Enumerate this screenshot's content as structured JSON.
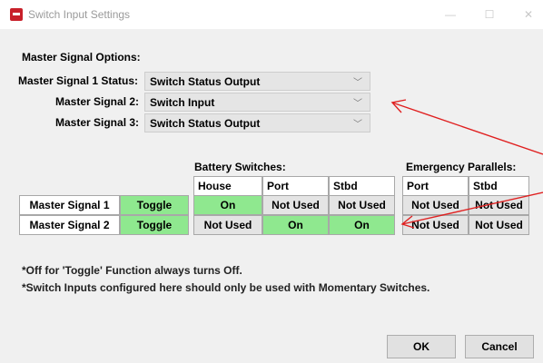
{
  "window": {
    "title": "Switch Input Settings",
    "minimize_glyph": "—",
    "maximize_glyph": "☐",
    "close_glyph": "✕"
  },
  "master_options": {
    "heading": "Master Signal Options:",
    "rows": [
      {
        "label": "Master Signal 1 Status:",
        "value": "Switch Status Output"
      },
      {
        "label": "Master Signal 2:",
        "value": "Switch Input"
      },
      {
        "label": "Master Signal 3:",
        "value": "Switch Status Output"
      }
    ]
  },
  "grid": {
    "group_battery": "Battery Switches:",
    "group_emergency": "Emergency Parallels:",
    "columns": [
      "House",
      "Port",
      "Stbd",
      "Port",
      "Stbd"
    ],
    "rows": [
      {
        "label": "Master Signal 1",
        "mode": "Toggle",
        "cells": [
          "On",
          "Not Used",
          "Not Used",
          "Not Used",
          "Not Used"
        ]
      },
      {
        "label": "Master Signal 2",
        "mode": "Toggle",
        "cells": [
          "Not Used",
          "On",
          "On",
          "Not Used",
          "Not Used"
        ]
      }
    ]
  },
  "notes": [
    "*Off for 'Toggle' Function always turns Off.",
    "*Switch Inputs configured here should only be used with Momentary Switches."
  ],
  "buttons": {
    "ok": "OK",
    "cancel": "Cancel"
  },
  "colors": {
    "on_cell": "#8fe88f",
    "arrow": "#e02020"
  }
}
